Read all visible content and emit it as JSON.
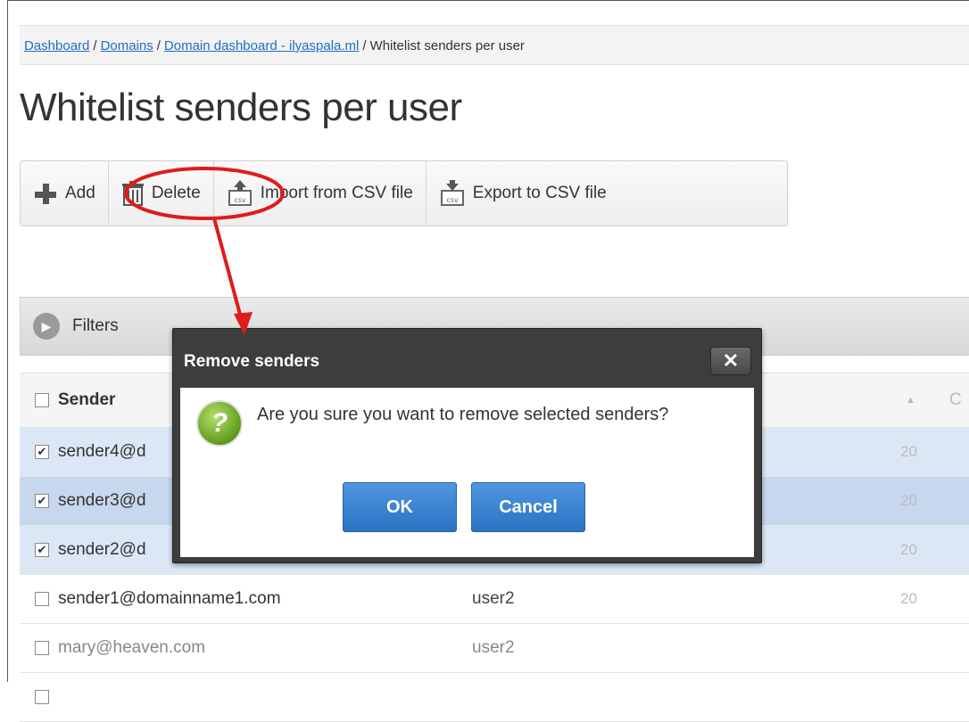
{
  "breadcrumb": {
    "items": [
      "Dashboard",
      "Domains",
      "Domain dashboard - ilyaspala.ml"
    ],
    "current": "Whitelist senders per user",
    "separator": "/"
  },
  "page_title": "Whitelist senders per user",
  "toolbar": {
    "add": "Add",
    "delete": "Delete",
    "import": "Import from CSV file",
    "export": "Export to CSV file"
  },
  "filters": {
    "label": "Filters"
  },
  "table": {
    "header": {
      "sender": "Sender",
      "c_partial": "C"
    },
    "rows": [
      {
        "sender": "sender4@d",
        "user": "",
        "date": "20",
        "checked": true
      },
      {
        "sender": "sender3@d",
        "user": "",
        "date": "20",
        "checked": true
      },
      {
        "sender": "sender2@d",
        "user": "",
        "date": "20",
        "checked": true
      },
      {
        "sender": "sender1@domainname1.com",
        "user": "user2",
        "date": "20",
        "checked": false
      },
      {
        "sender": "mary@heaven.com",
        "user": "user2",
        "date": "",
        "checked": false
      }
    ]
  },
  "dialog": {
    "title": "Remove senders",
    "close": "✕",
    "message": "Are you sure you want to remove selected senders?",
    "icon_glyph": "?",
    "ok": "OK",
    "cancel": "Cancel"
  },
  "colors": {
    "link": "#1f6fc5",
    "dialog_frame": "#3d3d3d",
    "primary_button": "#2b72c3",
    "selected_row": "#dce7f6",
    "annotation": "#e01b1b"
  },
  "icons": {
    "add": "plus-icon",
    "delete": "trash-icon",
    "import": "csv-upload-icon",
    "export": "csv-download-icon",
    "filters": "chevron-right-circle-icon",
    "dialog": "question-icon"
  }
}
